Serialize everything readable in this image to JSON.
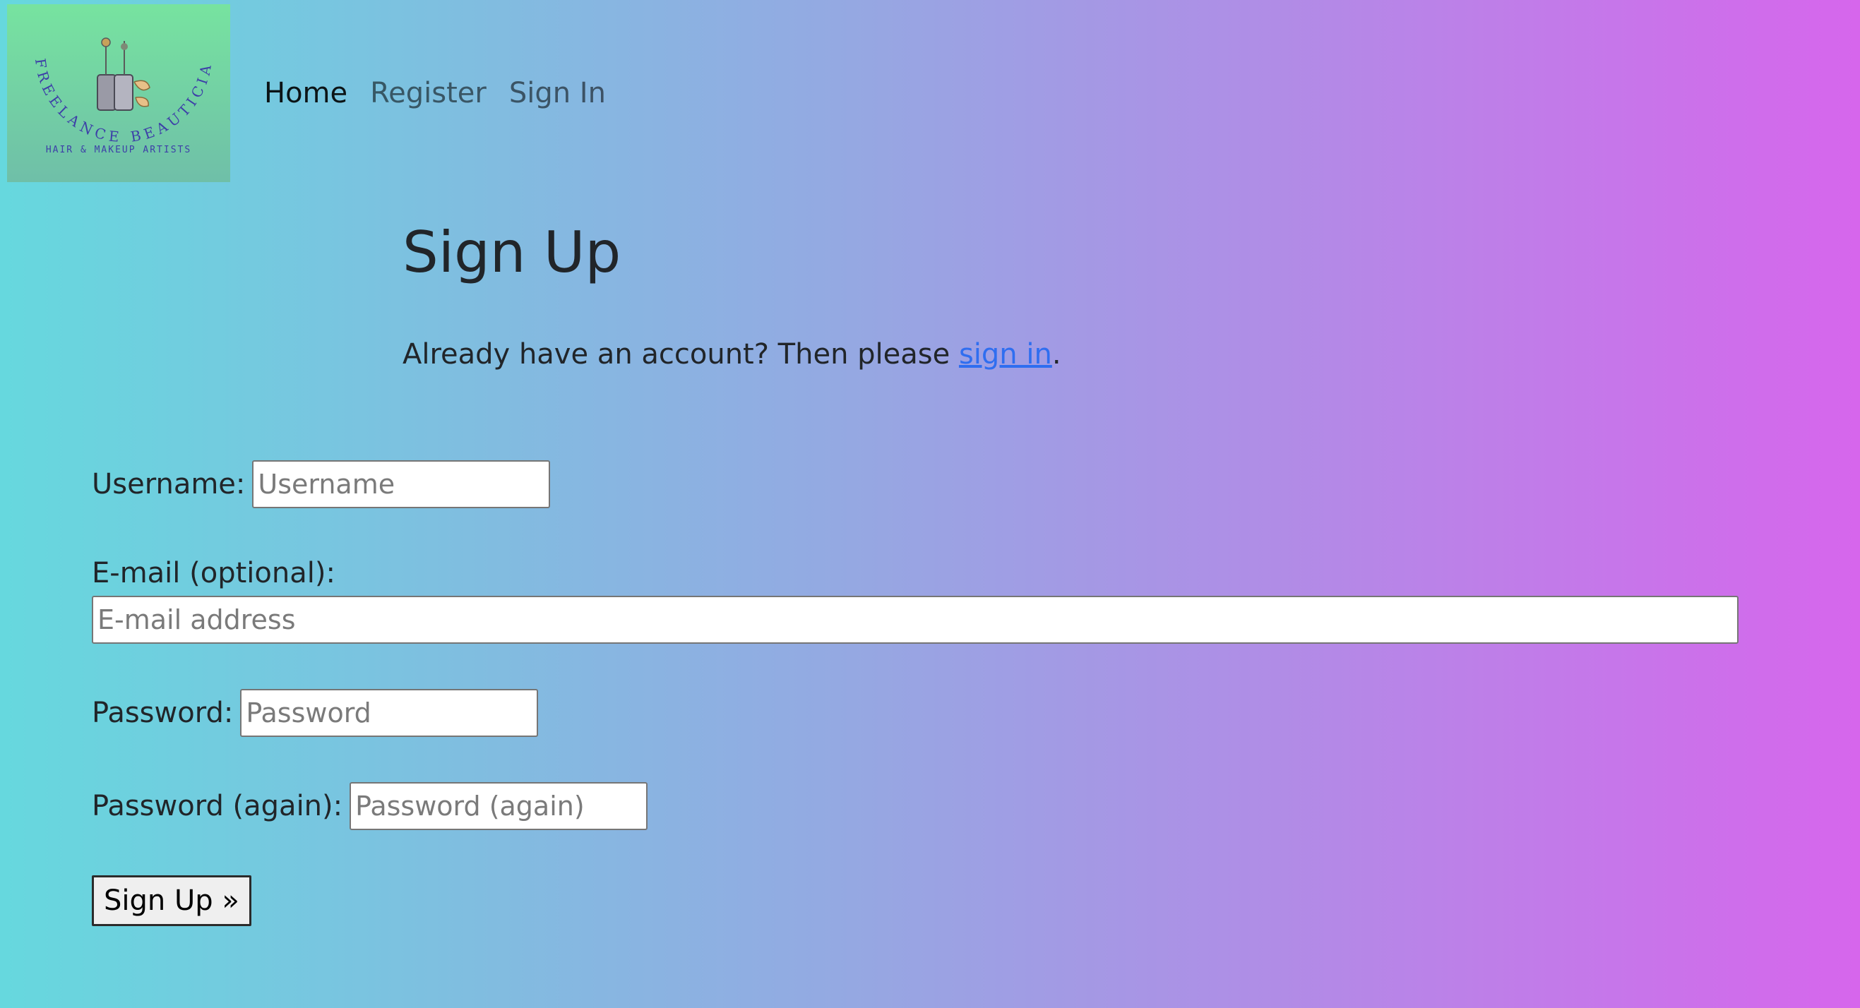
{
  "logo": {
    "top_text": "FREELANCE BEAUTICIANS",
    "bottom_text": "HAIR & MAKEUP ARTISTS"
  },
  "nav": {
    "home": "Home",
    "register": "Register",
    "sign_in": "Sign In"
  },
  "page": {
    "title": "Sign Up",
    "intro_prefix": "Already have an account? Then please ",
    "intro_link": "sign in",
    "intro_suffix": "."
  },
  "form": {
    "username_label": "Username:",
    "username_placeholder": "Username",
    "email_label": "E-mail (optional):",
    "email_placeholder": "E-mail address",
    "password_label": "Password:",
    "password_placeholder": "Password",
    "password2_label": "Password (again):",
    "password2_placeholder": "Password (again)",
    "submit_label": "Sign Up »"
  },
  "colors": {
    "gradient_left": "#66d8de",
    "gradient_right": "#d666ec",
    "link": "#2f6ef0"
  }
}
